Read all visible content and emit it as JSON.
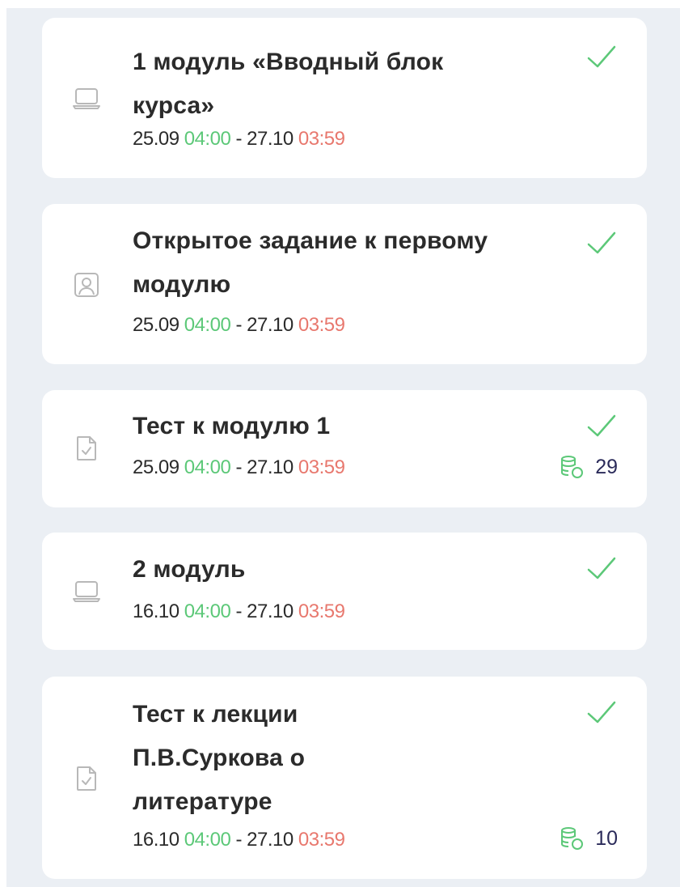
{
  "cards": [
    {
      "icon": "laptop-icon",
      "title": "1 модуль «Вводный блок курса»",
      "start_date": "25.09",
      "start_time": "04:00",
      "separator": "-",
      "end_date": "27.10",
      "end_time": "03:59",
      "completed": true
    },
    {
      "icon": "user-portrait-icon",
      "title": "Открытое задание к первому модулю",
      "start_date": "25.09",
      "start_time": "04:00",
      "separator": "-",
      "end_date": "27.10",
      "end_time": "03:59",
      "completed": true
    },
    {
      "icon": "test-document-icon",
      "title": "Тест к модулю 1",
      "start_date": "25.09",
      "start_time": "04:00",
      "separator": "-",
      "end_date": "27.10",
      "end_time": "03:59",
      "completed": true,
      "points": "29",
      "points_icon": "coins-icon"
    },
    {
      "icon": "laptop-icon",
      "title": "2 модуль",
      "start_date": "16.10",
      "start_time": "04:00",
      "separator": "-",
      "end_date": "27.10",
      "end_time": "03:59",
      "completed": true
    },
    {
      "icon": "test-document-icon",
      "title": "Тест к лекции П.В.Суркова о литературе",
      "start_date": "16.10",
      "start_time": "04:00",
      "separator": "-",
      "end_date": "27.10",
      "end_time": "03:59",
      "completed": true,
      "points": "10",
      "points_icon": "coins-icon"
    }
  ],
  "colors": {
    "start_time": "#5cc878",
    "end_time": "#e8786e",
    "check": "#5cc878",
    "background": "#ebeff4"
  }
}
